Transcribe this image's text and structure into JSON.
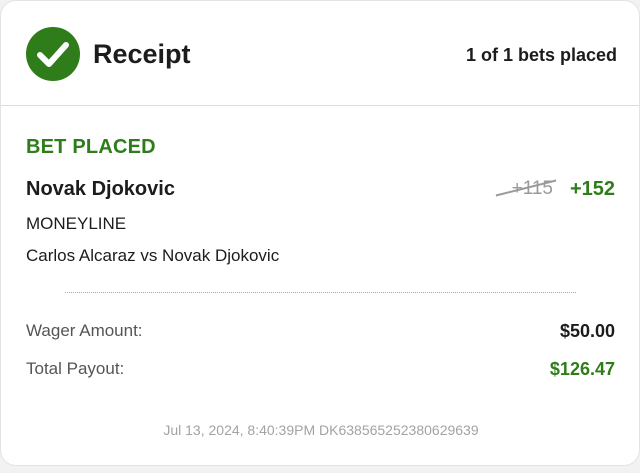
{
  "header": {
    "title": "Receipt",
    "bets_count": "1 of 1 bets placed",
    "icon": "check-circle-icon"
  },
  "bet": {
    "status": "BET PLACED",
    "selection": "Novak Djokovic",
    "odds_old": "+115",
    "odds_new": "+152",
    "market": "MONEYLINE",
    "event": "Carlos Alcaraz vs Novak Djokovic"
  },
  "summary": {
    "wager_label": "Wager Amount:",
    "wager_value": "$50.00",
    "payout_label": "Total Payout:",
    "payout_value": "$126.47"
  },
  "footer": {
    "meta": "Jul 13, 2024, 8:40:39PM DK638565252380629639"
  },
  "colors": {
    "accent_green": "#2e7d1a",
    "text_dark": "#1c1c1c",
    "muted": "#a3a3a3"
  }
}
